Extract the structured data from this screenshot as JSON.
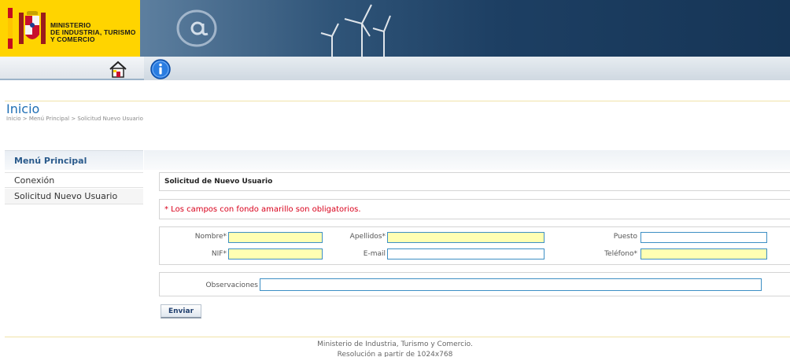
{
  "header": {
    "logo_text_line1": "MINISTERIO",
    "logo_text_line2": "DE INDUSTRIA, TURISMO",
    "logo_text_line3": "Y COMERCIO",
    "icons": [
      "spain-coat-of-arms-icon",
      "at-sign-icon",
      "wind-turbine-icon"
    ]
  },
  "toolbar": {
    "icons": [
      "home-icon",
      "info-icon"
    ]
  },
  "page": {
    "title": "Inicio",
    "breadcrumb": "Inicio > Menú Principal > Solicitud Nuevo Usuario"
  },
  "sidebar": {
    "header": "Menú Principal",
    "items": [
      {
        "label": "Conexión"
      },
      {
        "label": "Solicitud Nuevo Usuario"
      }
    ]
  },
  "form": {
    "section_title": "Solicitud de Nuevo Usuario",
    "required_notice": "* Los campos con fondo amarillo son obligatorios.",
    "fields": {
      "nombre_label": "Nombre*",
      "apellidos_label": "Apellidos*",
      "puesto_label": "Puesto",
      "nif_label": "NIF*",
      "email_label": "E-mail",
      "telefono_label": "Teléfono*",
      "observaciones_label": "Observaciones"
    },
    "values": {
      "nombre": "",
      "apellidos": "",
      "puesto": "",
      "nif": "",
      "email": "",
      "telefono": "",
      "observaciones": ""
    },
    "submit_label": "Enviar"
  },
  "footer": {
    "line1": "Ministerio de Industria, Turismo y Comercio.",
    "line2": "Resolución a partir de 1024x768"
  },
  "colors": {
    "required_field_bg": "#ffffb3",
    "field_border": "#3d8fc4",
    "notice_red": "#d9001b",
    "title_blue": "#1f6fb5",
    "logo_yellow": "#ffd400"
  }
}
